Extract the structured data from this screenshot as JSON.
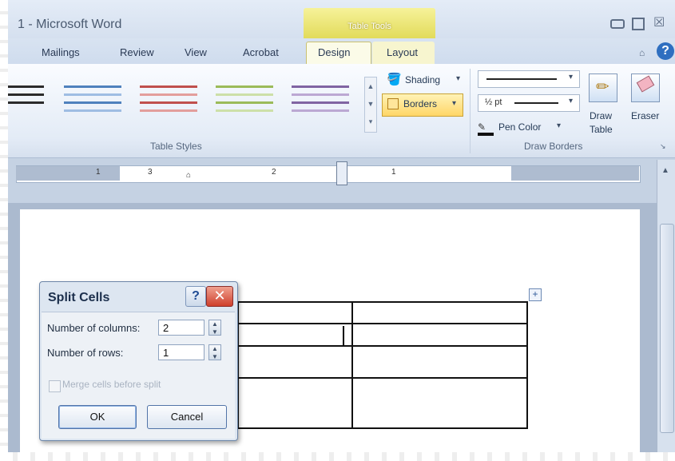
{
  "window": {
    "title": "1 - Microsoft Word",
    "contextual_tab_group": "Table Tools"
  },
  "tabs": [
    "Mailings",
    "Review",
    "View",
    "Acrobat",
    "Design",
    "Layout"
  ],
  "ribbon": {
    "table_styles_label": "Table Styles",
    "shading_label": "Shading",
    "borders_label": "Borders",
    "pen_weight": "½ pt",
    "pen_color_label": "Pen Color",
    "draw_table_label_1": "Draw",
    "draw_table_label_2": "Table",
    "eraser_label": "Eraser",
    "draw_borders_label": "Draw Borders"
  },
  "style_colors": [
    "#2b2b2b",
    "#4f81bd",
    "#c0504d",
    "#9bbb59",
    "#8064a2"
  ],
  "dialog": {
    "title": "Split Cells",
    "help": "?",
    "close": "✕",
    "columns_label": "Number of columns:",
    "columns_value": "2",
    "rows_label": "Number of rows:",
    "rows_value": "1",
    "merge_label": "Merge cells before split",
    "ok": "OK",
    "cancel": "Cancel"
  },
  "ruler": {
    "marks": [
      "1",
      "3",
      "2",
      "1"
    ]
  },
  "table_move_handle": "+"
}
